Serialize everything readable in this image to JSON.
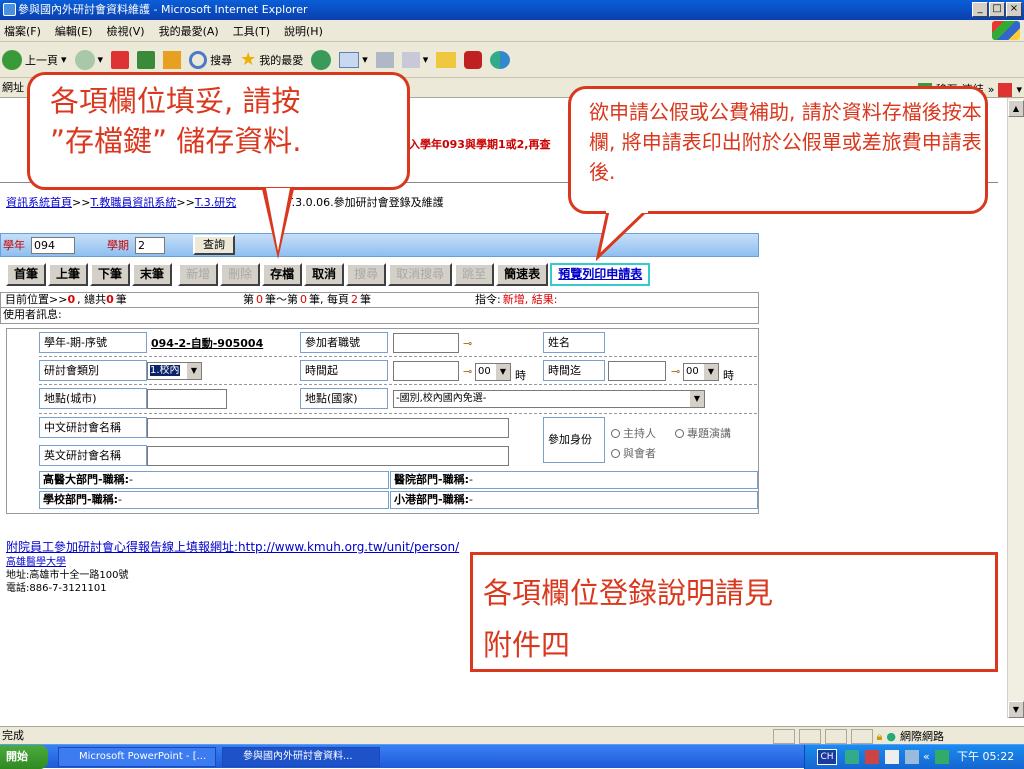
{
  "window": {
    "title": "參與國內外研討會資料維護 - Microsoft Internet Explorer",
    "buttons": [
      "_",
      "□",
      "×"
    ]
  },
  "menu": [
    "檔案(F)",
    "編輯(E)",
    "檢視(V)",
    "我的最愛(A)",
    "工具(T)",
    "說明(H)"
  ],
  "toolbar": {
    "back": "上一頁",
    "search": "搜尋",
    "favorites": "我的最愛"
  },
  "address": {
    "label": "網址",
    "go": "移至",
    "links": "連結"
  },
  "callouts": {
    "save_line1": "各項欄位填妥, 請按",
    "save_line2": "”存檔鍵” 儲存資料.",
    "print": "欲申請公假或公費補助, 請於資料存檔後按本欄, 將申請表印出附於公假單或差旅費申請表後.",
    "help_line1": "各項欄位登錄說明請見",
    "help_line2": "附件四"
  },
  "notice": "入學年093與學期1或2,再查",
  "breadcrumb": {
    "home": "資訊系統首頁",
    "sep1": ">>",
    "system": "T.教職員資訊系統",
    "sep2": ">>",
    "module": "T.3.研究",
    "rest": "T.3.0.06.參加研討會登錄及維護"
  },
  "query": {
    "year_label": "學年",
    "year_value": "094",
    "term_label": "學期",
    "term_value": "2",
    "button": "查詢"
  },
  "nav": [
    {
      "label": "首筆",
      "enabled": true
    },
    {
      "label": "上筆",
      "enabled": true
    },
    {
      "label": "下筆",
      "enabled": true
    },
    {
      "label": "末筆",
      "enabled": true
    },
    {
      "label": "新增",
      "enabled": false
    },
    {
      "label": "刪除",
      "enabled": false
    },
    {
      "label": "存檔",
      "enabled": true
    },
    {
      "label": "取消",
      "enabled": true
    },
    {
      "label": "搜尋",
      "enabled": false
    },
    {
      "label": "取消搜尋",
      "enabled": false
    },
    {
      "label": "跳至",
      "enabled": false
    },
    {
      "label": "簡速表",
      "enabled": true
    },
    {
      "label": "預覽列印申請表",
      "enabled": true
    }
  ],
  "status": {
    "pos_label": "目前位置>>",
    "pos_value": "0",
    "total_label": ", 總共",
    "total_value": "0",
    "total_unit": "筆",
    "page_a": "第",
    "page_start": "0",
    "page_b": "筆～第",
    "page_end": "0",
    "page_c": "筆, 每頁",
    "page_size": "2",
    "page_d": "筆",
    "cmd_label": "指令:",
    "cmd_value": "新增, 結果:",
    "user_msg": "使用者訊息:"
  },
  "form": {
    "serial_label": "學年-期-序號",
    "serial_value": "094-2-自動-905004",
    "participant_label": "參加者職號",
    "name_label": "姓名",
    "category_label": "研討會類別",
    "category_value": "1.校內",
    "time_start_label": "時間起",
    "time_end_label": "時間迄",
    "hour_value": "00",
    "hour_unit": "時",
    "city_label": "地點(城市)",
    "country_label": "地點(國家)",
    "country_value": "-國別,校內國內免選-",
    "cn_name_label": "中文研討會名稱",
    "en_name_label": "英文研討會名稱",
    "role_label": "參加身份",
    "role_options": [
      "主持人",
      "專題演講",
      "與會者"
    ],
    "dept1_label": "高醫大部門-職稱:",
    "dept1_value": "-",
    "dept2_label": "醫院部門-職稱:",
    "dept2_value": "-",
    "dept3_label": "學校部門-職稱:",
    "dept3_value": "-",
    "dept4_label": "小港部門-職稱:",
    "dept4_value": "-"
  },
  "report_link": "附院員工參加研討會心得報告線上填報網址:http://www.kmuh.org.tw/unit/person/",
  "footer": {
    "org": "高雄醫學大學",
    "address": "地址:高雄市十全一路100號",
    "phone": "電話:886-7-3121101"
  },
  "statusbar": {
    "left": "完成",
    "zone": "網際網路"
  },
  "taskbar": {
    "start": "開始",
    "task1": "Microsoft PowerPoint - [...",
    "task2": "參與國內外研討會資料...",
    "clock": "下午 05:22",
    "ime": "CH"
  }
}
